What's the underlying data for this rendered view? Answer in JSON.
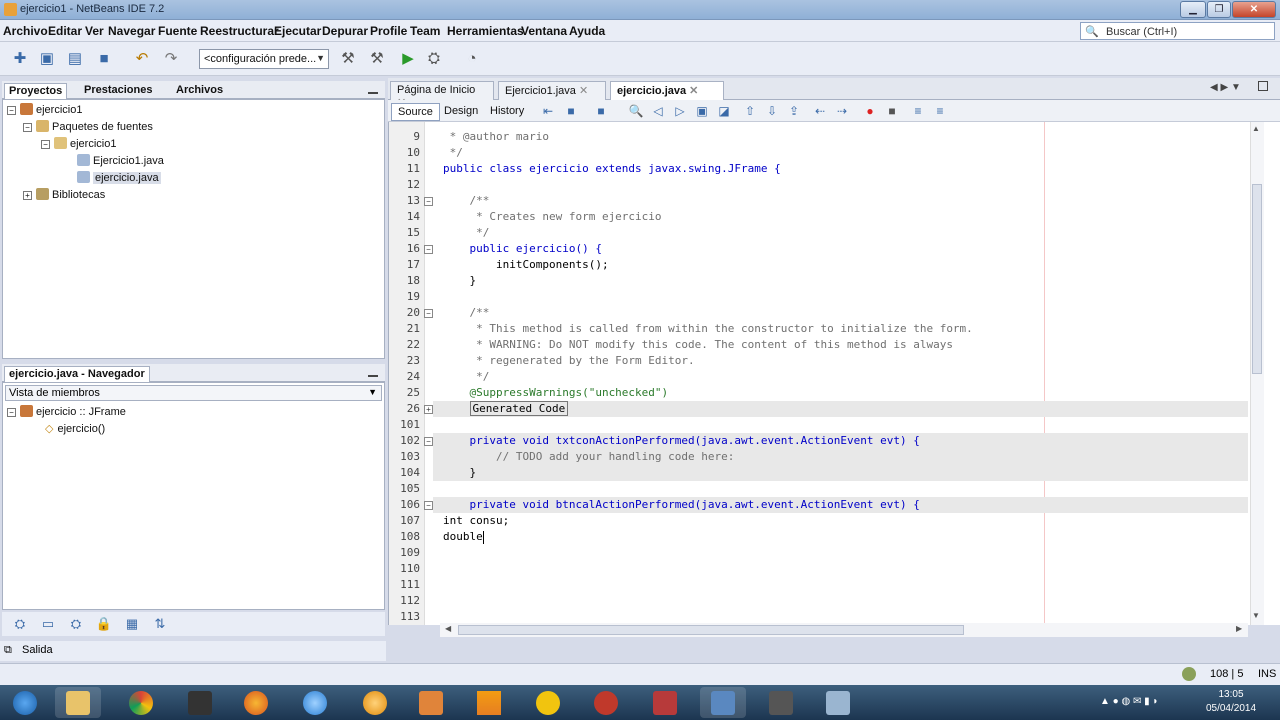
{
  "window": {
    "title": "ejercicio1 - NetBeans IDE 7.2"
  },
  "menu": [
    "Archivo",
    "Editar",
    "Ver",
    "Navegar",
    "Fuente",
    "Reestructurar",
    "Ejecutar",
    "Depurar",
    "Profile",
    "Team",
    "Herramientas",
    "Ventana",
    "Ayuda"
  ],
  "search": {
    "placeholder": "Buscar (Ctrl+I)"
  },
  "toolbar": {
    "config": "<configuración prede..."
  },
  "projects": {
    "tabs": [
      "Proyectos",
      "Prestaciones",
      "Archivos"
    ],
    "tree": [
      {
        "label": "ejercicio1",
        "level": 0
      },
      {
        "label": "Paquetes de fuentes",
        "level": 1
      },
      {
        "label": "ejercicio1",
        "level": 2
      },
      {
        "label": "Ejercicio1.java",
        "level": 3
      },
      {
        "label": "ejercicio.java",
        "level": 3,
        "selected": true
      },
      {
        "label": "Bibliotecas",
        "level": 1
      }
    ]
  },
  "navigator": {
    "title": "ejercicio.java - Navegador",
    "filter": "Vista de miembros",
    "tree": [
      "ejercicio :: JFrame",
      "ejercicio()"
    ]
  },
  "editor": {
    "tabs": [
      "Página de Inicio",
      "Ejercicio1.java",
      "ejercicio.java"
    ],
    "modes": [
      "Source",
      "Design",
      "History"
    ],
    "lines": [
      {
        "n": "9",
        "text": " * @author mario",
        "cls": "cm"
      },
      {
        "n": "10",
        "text": " */",
        "cls": "cm"
      },
      {
        "n": "11",
        "text": "public class ejercicio extends javax.swing.JFrame {",
        "cls": "kw"
      },
      {
        "n": "12",
        "text": ""
      },
      {
        "n": "13",
        "text": "    /**",
        "cls": "cm"
      },
      {
        "n": "14",
        "text": "     * Creates new form ejercicio",
        "cls": "cm"
      },
      {
        "n": "15",
        "text": "     */",
        "cls": "cm"
      },
      {
        "n": "16",
        "text": "    public ejercicio() {",
        "cls": "kw"
      },
      {
        "n": "17",
        "text": "        initComponents();"
      },
      {
        "n": "18",
        "text": "    }"
      },
      {
        "n": "19",
        "text": ""
      },
      {
        "n": "20",
        "text": "    /**",
        "cls": "cm"
      },
      {
        "n": "21",
        "text": "     * This method is called from within the constructor to initialize the form.",
        "cls": "cm"
      },
      {
        "n": "22",
        "text": "     * WARNING: Do NOT modify this code. The content of this method is always",
        "cls": "cm"
      },
      {
        "n": "23",
        "text": "     * regenerated by the Form Editor.",
        "cls": "cm"
      },
      {
        "n": "24",
        "text": "     */",
        "cls": "cm"
      },
      {
        "n": "25",
        "text": "    @SuppressWarnings(\"unchecked\")",
        "cls": "an"
      },
      {
        "n": "26",
        "text": "    Generated Code",
        "cls": "box"
      },
      {
        "n": "101",
        "text": ""
      },
      {
        "n": "102",
        "text": "    private void txtconActionPerformed(java.awt.event.ActionEvent evt) {",
        "cls": "kw"
      },
      {
        "n": "103",
        "text": "        // TODO add your handling code here:",
        "cls": "cm"
      },
      {
        "n": "104",
        "text": "    }"
      },
      {
        "n": "105",
        "text": ""
      },
      {
        "n": "106",
        "text": "    private void btncalActionPerformed(java.awt.event.ActionEvent evt) {",
        "cls": "kw"
      },
      {
        "n": "107",
        "text": "int consu;"
      },
      {
        "n": "108",
        "text": "double"
      },
      {
        "n": "109",
        "text": ""
      },
      {
        "n": "110",
        "text": ""
      },
      {
        "n": "111",
        "text": ""
      },
      {
        "n": "112",
        "text": ""
      },
      {
        "n": "113",
        "text": ""
      }
    ]
  },
  "output": {
    "label": "Salida"
  },
  "status": {
    "position": "108 | 5",
    "mode": "INS"
  },
  "clock": {
    "time": "13:05",
    "date": "05/04/2014"
  }
}
